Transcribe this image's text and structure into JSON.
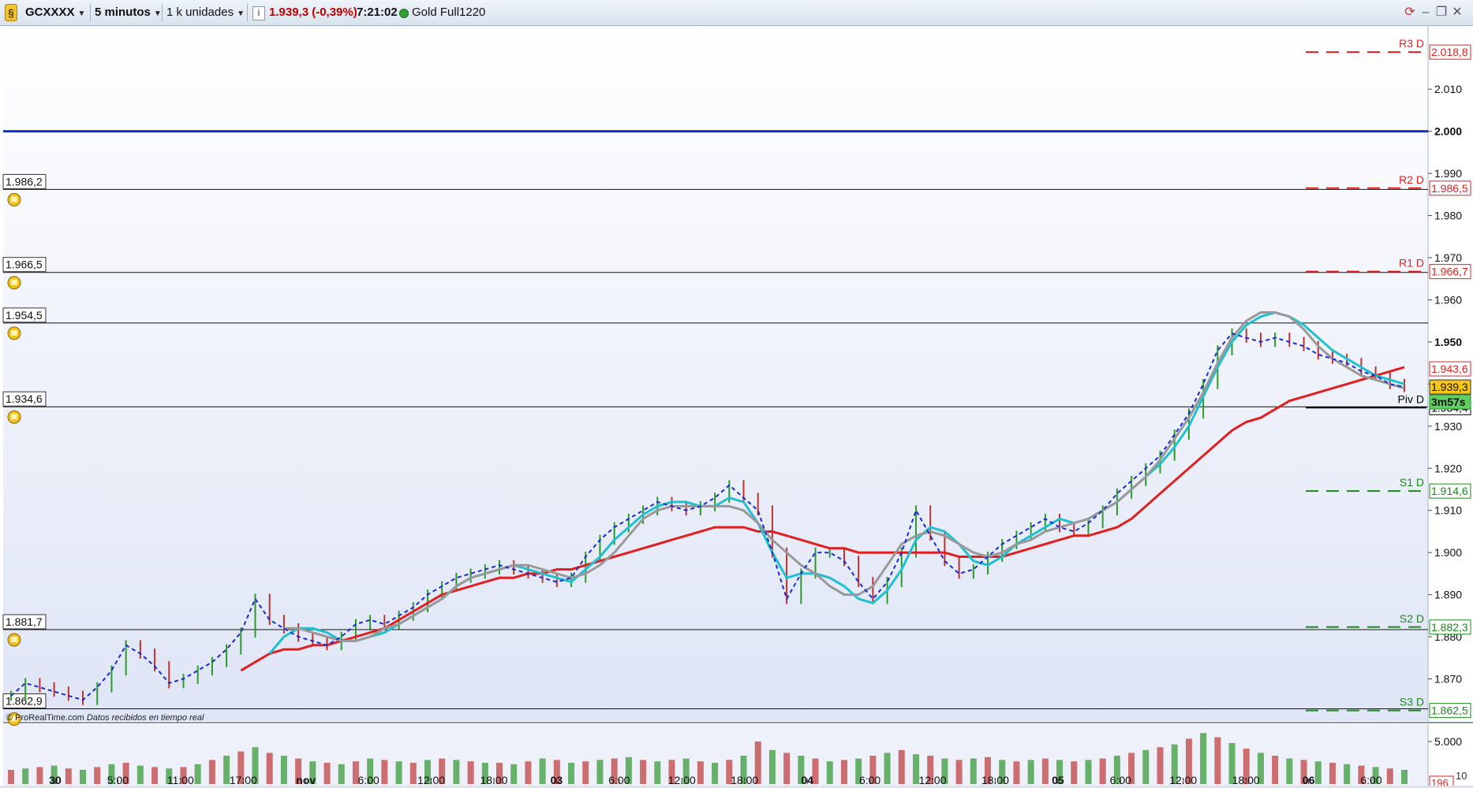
{
  "toolbar": {
    "symbol": "GCXXXX",
    "timeframe": "5 minutos",
    "units": "1 k unidades",
    "price_change": "1.939,3 (-0,39%)",
    "time": "7:21:02",
    "instrument": "Gold Full1220",
    "colors": {
      "change": "#c00000",
      "status_dot": "#2fa02f"
    }
  },
  "chart_data": {
    "type": "line",
    "symbol": "GCXXXX",
    "interval": "5 minutos",
    "last_price": "1.939,3",
    "countdown": "3m57s",
    "price_axis": {
      "ylim": [
        1860,
        2025
      ],
      "ticks": [
        "2.010",
        "2.000",
        "1.990",
        "1.980",
        "1.970",
        "1.960",
        "1.950",
        "1.940",
        "1.930",
        "1.920",
        "1.910",
        "1.900",
        "1.890",
        "1.880",
        "1.870"
      ],
      "tick_values": [
        2010,
        2000,
        1990,
        1980,
        1970,
        1960,
        1950,
        1940,
        1930,
        1920,
        1910,
        1900,
        1890,
        1880,
        1870
      ]
    },
    "time_axis": {
      "labels": [
        "30",
        "5:00",
        "11:00",
        "17:00",
        "nov",
        "6:00",
        "12:00",
        "18:00",
        "03",
        "6:00",
        "12:00",
        "18:00",
        "04",
        "6:00",
        "12:00",
        "18:00",
        "05",
        "6:00",
        "12:00",
        "18:00",
        "06",
        "6:00"
      ],
      "bold": [
        "30",
        "nov",
        "03",
        "04",
        "05",
        "06"
      ]
    },
    "horizontal_lines": [
      {
        "value": 1986.2,
        "label": "1.986,2"
      },
      {
        "value": 1966.5,
        "label": "1.966,5"
      },
      {
        "value": 1954.5,
        "label": "1.954,5"
      },
      {
        "value": 1934.6,
        "label": "1.934,6"
      },
      {
        "value": 1881.7,
        "label": "1.881,7"
      },
      {
        "value": 1862.9,
        "label": "1.862,9"
      }
    ],
    "blue_line": {
      "value": 2000,
      "label": "2.000"
    },
    "pivots": [
      {
        "name": "R3 D",
        "value": 2018.8,
        "label": "2.018,8",
        "color": "#e02020"
      },
      {
        "name": "R2 D",
        "value": 1986.5,
        "label": "1.986,5",
        "color": "#e02020"
      },
      {
        "name": "R1 D",
        "value": 1966.7,
        "label": "1.966,7",
        "color": "#e02020"
      },
      {
        "name": "Piv D",
        "value": 1934.4,
        "label": "1.934,4",
        "color": "#000000"
      },
      {
        "name": "S1 D",
        "value": 1914.6,
        "label": "1.914,6",
        "color": "#1a8a1a"
      },
      {
        "name": "S2 D",
        "value": 1882.3,
        "label": "1.882,3",
        "color": "#1a8a1a"
      },
      {
        "name": "S3 D",
        "value": 1862.5,
        "label": "1.862,5",
        "color": "#1a8a1a"
      }
    ],
    "extra_price_label": {
      "value": 1943.6,
      "label": "1.943,6"
    },
    "series": [
      {
        "key": "price",
        "color": "#444444",
        "values": [
          1866,
          1869,
          1868,
          1867,
          1866,
          1865,
          1868,
          1872,
          1878,
          1876,
          1873,
          1869,
          1870,
          1872,
          1874,
          1877,
          1881,
          1889,
          1884,
          1882,
          1880,
          1879,
          1878,
          1880,
          1883,
          1884,
          1883,
          1885,
          1887,
          1890,
          1892,
          1894,
          1895,
          1896,
          1897,
          1896,
          1895,
          1894,
          1893,
          1894,
          1899,
          1903,
          1906,
          1908,
          1910,
          1912,
          1911,
          1910,
          1911,
          1913,
          1916,
          1913,
          1910,
          1900,
          1889,
          1895,
          1900,
          1900,
          1898,
          1893,
          1889,
          1893,
          1900,
          1910,
          1904,
          1898,
          1895,
          1896,
          1899,
          1902,
          1904,
          1906,
          1908,
          1906,
          1905,
          1907,
          1910,
          1914,
          1917,
          1920,
          1923,
          1928,
          1933,
          1940,
          1948,
          1952,
          1951,
          1950,
          1951,
          1950,
          1949,
          1947,
          1946,
          1945,
          1943,
          1942,
          1940,
          1939.3
        ]
      },
      {
        "key": "ma_red",
        "color": "#e02020",
        "values": [
          null,
          null,
          null,
          null,
          null,
          null,
          null,
          null,
          null,
          null,
          null,
          null,
          null,
          null,
          null,
          null,
          1872,
          1874,
          1876,
          1877,
          1877,
          1878,
          1878,
          1879,
          1880,
          1881,
          1882,
          1884,
          1886,
          1888,
          1890,
          1891,
          1892,
          1893,
          1894,
          1894,
          1895,
          1895,
          1896,
          1896,
          1897,
          1898,
          1899,
          1900,
          1901,
          1902,
          1903,
          1904,
          1905,
          1906,
          1906,
          1906,
          1905,
          1905,
          1904,
          1903,
          1902,
          1901,
          1901,
          1900,
          1900,
          1900,
          1900,
          1900,
          1900,
          1900,
          1899,
          1899,
          1899,
          1899,
          1900,
          1901,
          1902,
          1903,
          1904,
          1904,
          1905,
          1906,
          1908,
          1911,
          1914,
          1917,
          1920,
          1923,
          1926,
          1929,
          1931,
          1932,
          1934,
          1936,
          1937,
          1938,
          1939,
          1940,
          1941,
          1942,
          1943,
          1944
        ]
      },
      {
        "key": "ma_cyan",
        "color": "#20c0d0",
        "values": [
          null,
          null,
          null,
          null,
          null,
          null,
          null,
          null,
          null,
          null,
          null,
          null,
          null,
          null,
          null,
          null,
          null,
          null,
          1876,
          1880,
          1882,
          1882,
          1881,
          1879,
          1879,
          1880,
          1881,
          1883,
          1885,
          1887,
          1889,
          1892,
          1894,
          1895,
          1896,
          1897,
          1896,
          1895,
          1894,
          1893,
          1896,
          1899,
          1903,
          1906,
          1909,
          1911,
          1912,
          1912,
          1911,
          1911,
          1913,
          1912,
          1907,
          1900,
          1894,
          1895,
          1895,
          1894,
          1892,
          1889,
          1888,
          1891,
          1896,
          1903,
          1906,
          1905,
          1902,
          1898,
          1897,
          1899,
          1902,
          1904,
          1906,
          1908,
          1907,
          1908,
          1910,
          1912,
          1915,
          1918,
          1921,
          1925,
          1930,
          1937,
          1944,
          1950,
          1954,
          1956,
          1957,
          1956,
          1954,
          1951,
          1948,
          1946,
          1944,
          1942,
          1941,
          1940
        ]
      },
      {
        "key": "ma_gray",
        "color": "#999999",
        "values": [
          null,
          null,
          null,
          null,
          null,
          null,
          null,
          null,
          null,
          null,
          null,
          null,
          null,
          null,
          null,
          null,
          null,
          null,
          null,
          1882,
          1882,
          1881,
          1880,
          1879,
          1879,
          1880,
          1882,
          1883,
          1885,
          1887,
          1889,
          1892,
          1894,
          1895,
          1896,
          1897,
          1897,
          1896,
          1895,
          1894,
          1895,
          1897,
          1900,
          1904,
          1908,
          1910,
          1911,
          1911,
          1911,
          1911,
          1911,
          1910,
          1907,
          1903,
          1900,
          1897,
          1895,
          1892,
          1890,
          1890,
          1892,
          1897,
          1902,
          1904,
          1905,
          1904,
          1902,
          1900,
          1899,
          1900,
          1902,
          1903,
          1905,
          1906,
          1907,
          1908,
          1910,
          1912,
          1915,
          1918,
          1922,
          1927,
          1932,
          1938,
          1945,
          1951,
          1955,
          1957,
          1957,
          1956,
          1953,
          1949,
          1946,
          1944,
          1942,
          1941,
          1940,
          1939
        ]
      }
    ],
    "volume_panel": {
      "ticks": [
        "5.000"
      ],
      "last_label": "196",
      "counter": "10"
    },
    "volume": [
      20,
      22,
      24,
      26,
      22,
      20,
      24,
      28,
      30,
      26,
      24,
      22,
      24,
      28,
      34,
      40,
      46,
      52,
      44,
      40,
      36,
      32,
      30,
      28,
      32,
      36,
      34,
      32,
      30,
      34,
      36,
      34,
      32,
      30,
      30,
      28,
      32,
      36,
      34,
      30,
      32,
      34,
      36,
      38,
      34,
      32,
      34,
      36,
      32,
      30,
      34,
      40,
      60,
      48,
      44,
      40,
      36,
      32,
      34,
      36,
      40,
      44,
      48,
      42,
      40,
      36,
      34,
      36,
      38,
      34,
      32,
      34,
      36,
      34,
      32,
      34,
      36,
      40,
      44,
      48,
      52,
      56,
      64,
      72,
      66,
      58,
      50,
      44,
      40,
      36,
      34,
      32,
      30,
      28,
      26,
      24,
      22,
      20
    ]
  },
  "footer": {
    "credit": "© ProRealTime.com",
    "note": "Datos recibidos en tiempo real"
  }
}
